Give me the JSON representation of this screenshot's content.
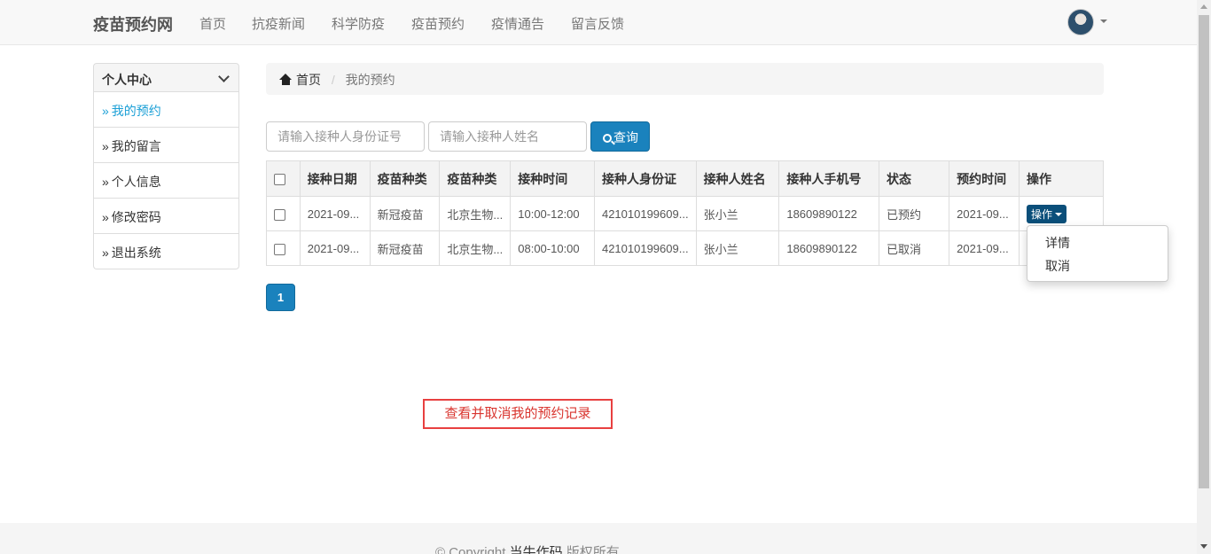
{
  "navbar": {
    "brand": "疫苗预约网",
    "links": [
      "首页",
      "抗疫新闻",
      "科学防疫",
      "疫苗预约",
      "疫情通告",
      "留言反馈"
    ]
  },
  "sidebar": {
    "title": "个人中心",
    "items": [
      {
        "label": "我的预约"
      },
      {
        "label": "我的留言"
      },
      {
        "label": "个人信息"
      },
      {
        "label": "修改密码"
      },
      {
        "label": "退出系统"
      }
    ],
    "bullet": "»"
  },
  "breadcrumb": {
    "home": "首页",
    "separator": "/",
    "current": "我的预约"
  },
  "search": {
    "id_placeholder": "请输入接种人身份证号",
    "name_placeholder": "请输入接种人姓名",
    "button_label": "查询"
  },
  "table": {
    "headers": [
      "接种日期",
      "疫苗种类",
      "疫苗种类",
      "接种时间",
      "接种人身份证",
      "接种人姓名",
      "接种人手机号",
      "状态",
      "预约时间",
      "操作"
    ],
    "rows": [
      [
        "2021-09...",
        "新冠疫苗",
        "北京生物...",
        "10:00-12:00",
        "421010199609...",
        "张小兰",
        "18609890122",
        "已预约",
        "2021-09..."
      ],
      [
        "2021-09...",
        "新冠疫苗",
        "北京生物...",
        "08:00-10:00",
        "421010199609...",
        "张小兰",
        "18609890122",
        "已取消",
        "2021-09..."
      ]
    ],
    "action_label": "操作"
  },
  "dropdown": {
    "items": [
      "详情",
      "取消"
    ]
  },
  "pagination": {
    "current_page": "1"
  },
  "annotation": "查看并取消我的预约记录",
  "footer": {
    "prefix": "© Copyright ",
    "name": "当牛作码",
    "suffix": " 版权所有"
  },
  "colors": {
    "primary": "#1a82bd",
    "active_link": "#1a9fd6",
    "annotation": "#e84040"
  }
}
